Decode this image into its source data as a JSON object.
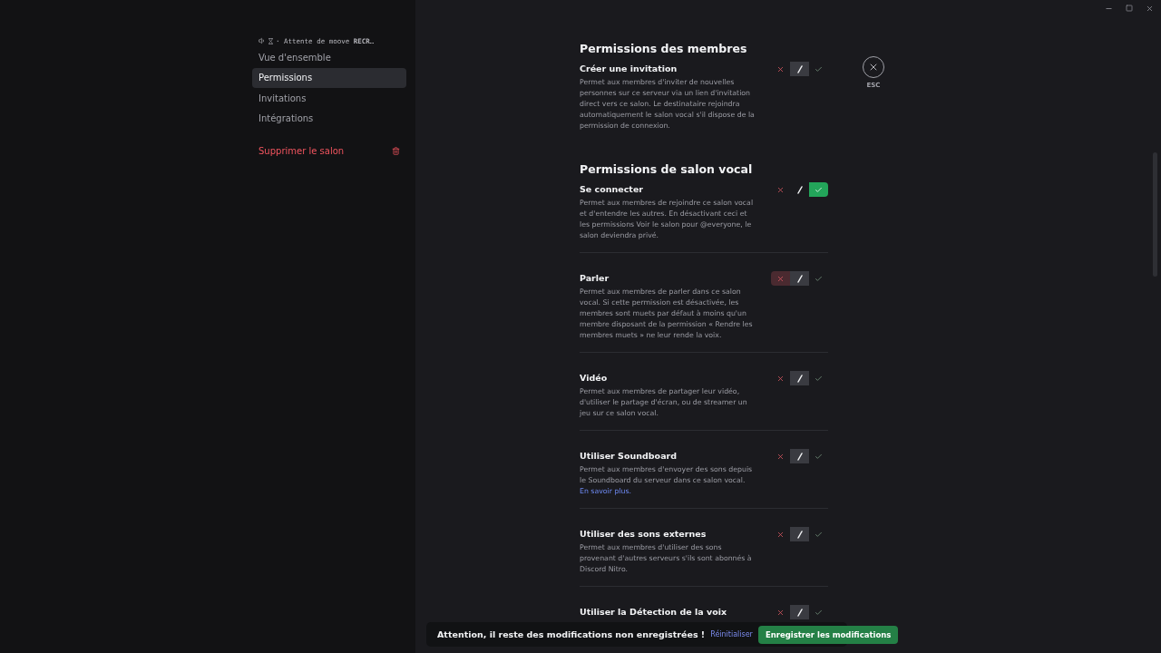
{
  "sidebar": {
    "channel_header": "· Attente de moove **RECR**…",
    "items": [
      {
        "label": "Vue d'ensemble",
        "selected": false
      },
      {
        "label": "Permissions",
        "selected": true
      },
      {
        "label": "Invitations",
        "selected": false
      },
      {
        "label": "Intégrations",
        "selected": false
      }
    ],
    "delete_label": "Supprimer le salon"
  },
  "close": {
    "label": "ESC"
  },
  "sections": [
    {
      "title": "Permissions des membres",
      "permissions": [
        {
          "name": "Créer une invitation",
          "description": "Permet aux membres d'inviter de nouvelles personnes sur ce serveur via un lien d'invitation direct vers ce salon. Le destinataire rejoindra automatiquement le salon vocal s'il dispose de la permission de connexion.",
          "denied": false,
          "allowed": false,
          "deny_hovered": false
        }
      ]
    },
    {
      "title": "Permissions de salon vocal",
      "permissions": [
        {
          "name": "Se connecter",
          "description": "Permet aux membres de rejoindre ce salon vocal et d'entendre les autres. En désactivant ceci et les permissions Voir le salon pour @everyone, le salon deviendra privé.",
          "denied": false,
          "allowed": true,
          "deny_hovered": false
        },
        {
          "name": "Parler",
          "description": "Permet aux membres de parler dans ce salon vocal. Si cette permission est désactivée, les membres sont muets par défaut à moins qu'un membre disposant de la permission « Rendre les membres muets » ne leur rende la voix.",
          "denied": false,
          "allowed": false,
          "deny_hovered": true
        },
        {
          "name": "Vidéo",
          "description": "Permet aux membres de partager leur vidéo, d'utiliser le partage d'écran, ou de streamer un jeu sur ce salon vocal.",
          "denied": false,
          "allowed": false,
          "deny_hovered": false
        },
        {
          "name": "Utiliser Soundboard",
          "description": "Permet aux membres d'envoyer des sons depuis le Soundboard du serveur dans ce salon vocal.",
          "link": "En savoir plus.",
          "denied": false,
          "allowed": false,
          "deny_hovered": false
        },
        {
          "name": "Utiliser des sons externes",
          "description": "Permet aux membres d'utiliser des sons provenant d'autres serveurs s'ils sont abonnés à Discord Nitro.",
          "denied": false,
          "allowed": false,
          "deny_hovered": false
        },
        {
          "name": "Utiliser la Détection de la voix",
          "denied": false,
          "allowed": false,
          "deny_hovered": false
        }
      ]
    }
  ],
  "notice": {
    "message": "Attention, il reste des modifications non enregistrées !",
    "reset": "Réinitialiser",
    "save": "Enregistrer les modifications"
  }
}
